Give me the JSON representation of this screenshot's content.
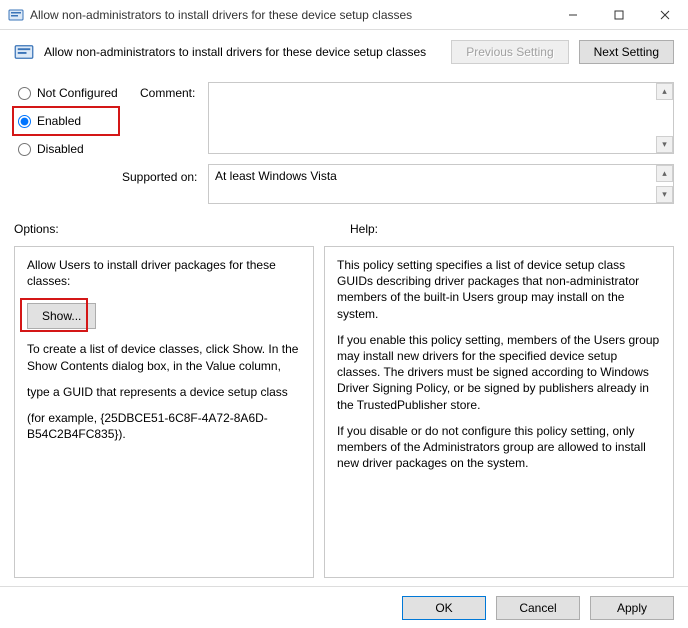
{
  "window": {
    "title": "Allow non-administrators to install drivers for these device setup classes"
  },
  "header": {
    "title": "Allow non-administrators to install drivers for these device setup classes",
    "prev": "Previous Setting",
    "next": "Next Setting"
  },
  "radios": {
    "not_configured": "Not Configured",
    "enabled": "Enabled",
    "disabled": "Disabled",
    "selected": "enabled"
  },
  "comment": {
    "label": "Comment:",
    "value": ""
  },
  "supported": {
    "label": "Supported on:",
    "value": "At least Windows Vista"
  },
  "labels": {
    "options": "Options:",
    "help": "Help:"
  },
  "options": {
    "line1": "Allow Users to install driver packages for these classes:",
    "show": "Show...",
    "line2": "To create a list of device classes, click Show. In the Show Contents dialog box, in the Value column,",
    "line3": "type a GUID that represents a device setup class",
    "line4": "(for example, {25DBCE51-6C8F-4A72-8A6D-B54C2B4FC835})."
  },
  "help": {
    "p1": "This policy setting specifies a list of device setup class GUIDs describing driver packages that non-administrator members of the built-in Users group may install on the system.",
    "p2": "If you enable this policy setting, members of the Users group may install new drivers for the specified device setup classes. The drivers must be signed according to Windows Driver Signing Policy, or be signed by publishers already in the TrustedPublisher store.",
    "p3": "If you disable or do not configure this policy setting, only members of the Administrators group are allowed to install new driver packages on the system."
  },
  "footer": {
    "ok": "OK",
    "cancel": "Cancel",
    "apply": "Apply"
  }
}
